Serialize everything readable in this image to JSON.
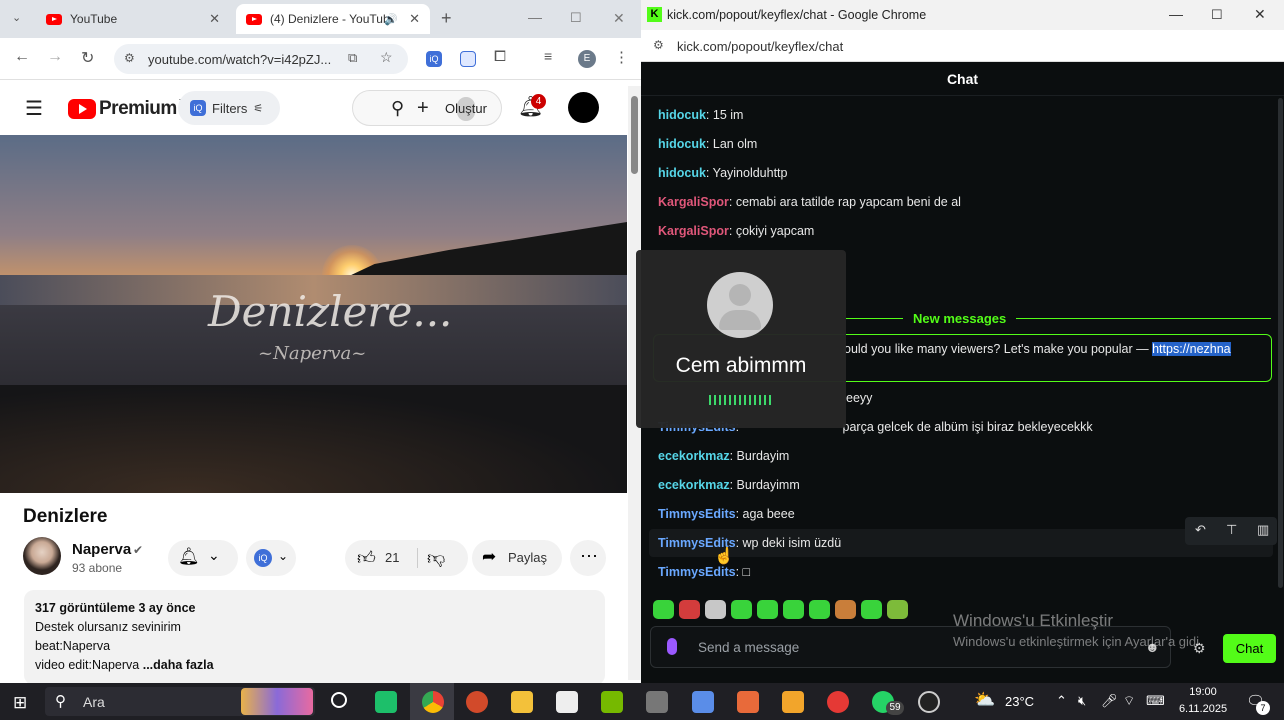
{
  "left_browser": {
    "tabs": [
      {
        "label": "YouTube"
      },
      {
        "label": "(4) Denizlere - YouTub"
      }
    ],
    "url": "youtube.com/watch?v=i42pZJ...",
    "profile_letter": "E"
  },
  "youtube": {
    "logo_text": "Premium",
    "logo_badge": "TR",
    "filters_label": "Filters",
    "create_label": "Oluştur",
    "notification_count": "4",
    "video": {
      "overlay_title": "Denizlere...",
      "overlay_artist": "~Naperva~",
      "title": "Denizlere",
      "channel": "Naperva",
      "subscribers": "93 abone",
      "likes": "21",
      "share_label": "Paylaş",
      "description": {
        "stats": "317 görüntüleme  3 ay önce",
        "line1": "Destek olursanız sevinirim",
        "line2": "beat:Naperva",
        "line3": "video edit:Naperva",
        "more": "...daha fazla"
      }
    }
  },
  "right_browser": {
    "window_title": "kick.com/popout/keyflex/chat - Google Chrome",
    "url": "kick.com/popout/keyflex/chat",
    "chat_title": "Chat",
    "new_messages_label": "New messages",
    "messages": [
      {
        "user": "hidocuk",
        "text": "15 im",
        "color": "#56d6e8"
      },
      {
        "user": "hidocuk",
        "text": "Lan olm",
        "color": "#56d6e8"
      },
      {
        "user": "hidocuk",
        "text": "Yayinolduhttp",
        "color": "#56d6e8"
      },
      {
        "user": "KargaliSpor",
        "text": "cemabi ara tatilde rap yapcam beni de al",
        "color": "#e0577a"
      },
      {
        "user": "KargaliSpor",
        "text": "çokiyi yapcam",
        "color": "#e0577a"
      }
    ],
    "promo_text": "ould you like many viewers? Let's make you popular — ",
    "promo_link": "https://nezhna",
    "after_messages": [
      {
        "user": "",
        "text": "eeyy",
        "color": "#56d6e8"
      },
      {
        "user": "TimmysEdits",
        "text": "parça gelcek de albüm işi biraz bekleyecekkk",
        "color": "#6aa8ff"
      },
      {
        "user": "ecekorkmaz",
        "text": "Burdayim",
        "color": "#56d6e8"
      },
      {
        "user": "ecekorkmaz",
        "text": "Burdayimm",
        "color": "#56d6e8"
      },
      {
        "user": "TimmysEdits",
        "text": "aga beee",
        "color": "#6aa8ff"
      },
      {
        "user": "TimmysEdits",
        "text": "wp deki isim üzdü",
        "color": "#6aa8ff"
      },
      {
        "user": "TimmysEdits",
        "text": "□",
        "color": "#6aa8ff"
      }
    ],
    "input_placeholder": "Send a message",
    "chat_button": "Chat",
    "activation_title": "Windows'u Etkinleştir",
    "activation_sub": "Windows'u etkinleştirmek için Ayarlar'a gidi"
  },
  "call_popup": {
    "name": "Cem abimmm"
  },
  "taskbar": {
    "search_label": "Ara",
    "whatsapp_badge": "59",
    "temperature": "23°C",
    "time": "19:00",
    "date": "6.11.2025",
    "notif_badge": "7"
  }
}
